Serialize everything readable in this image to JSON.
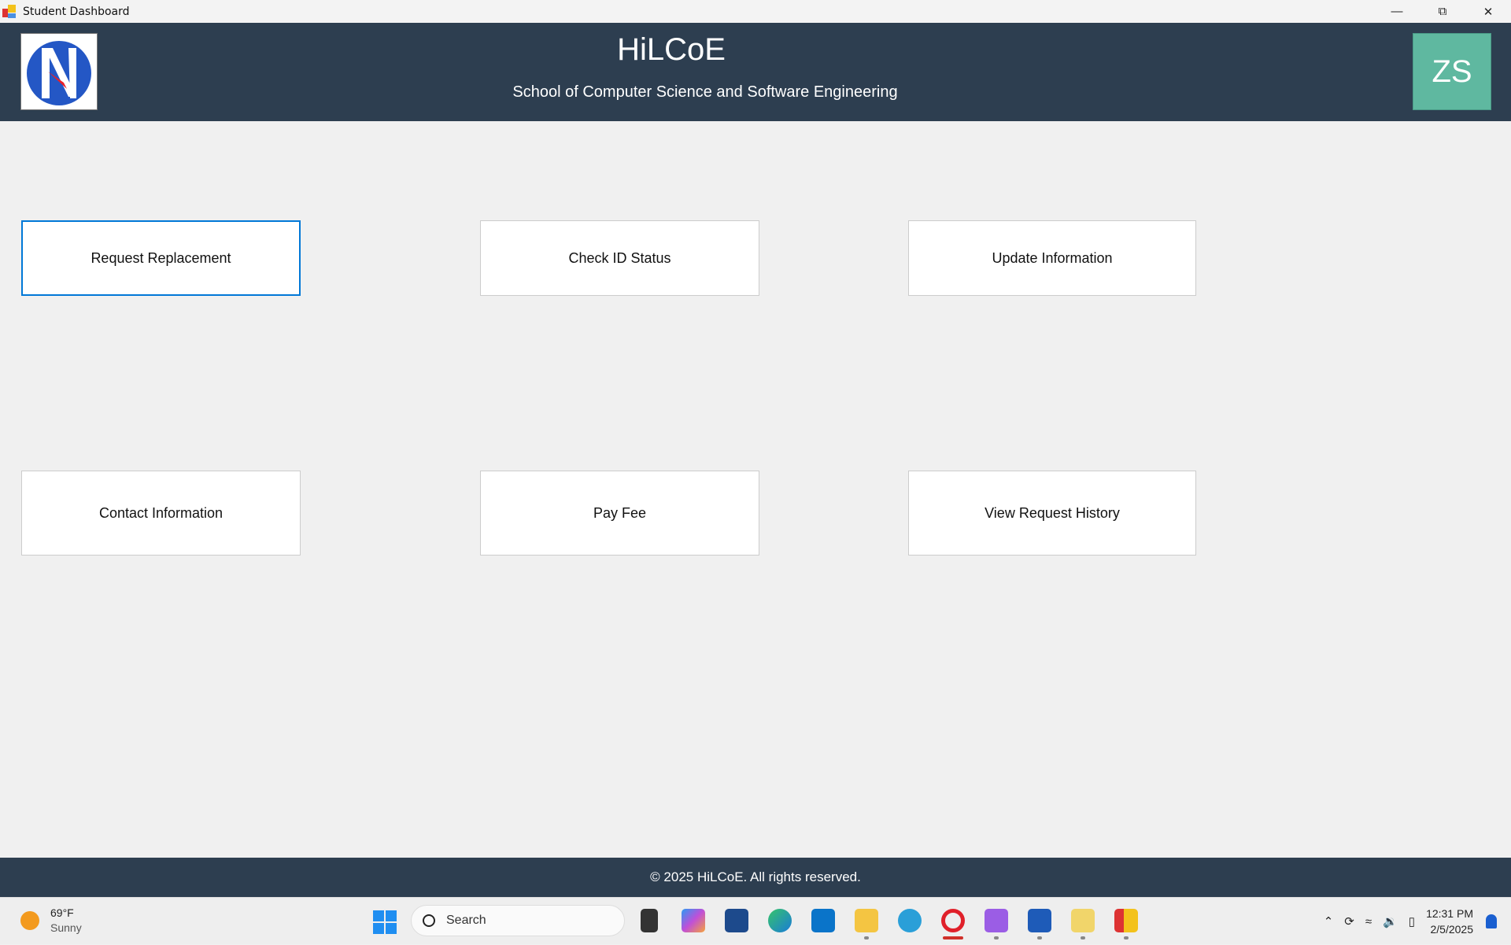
{
  "window": {
    "title": "Student Dashboard",
    "controls": [
      "minimize",
      "restore",
      "close"
    ]
  },
  "header": {
    "title": "HiLCoE",
    "subtitle": "School of Computer Science and Software Engineering",
    "avatar_initials": "ZS",
    "bg_color": "#2d3e50",
    "avatar_color": "#5fb8a0"
  },
  "actions": [
    {
      "label": "Request Replacement",
      "focused": true
    },
    {
      "label": "Check ID Status"
    },
    {
      "label": "Update Information"
    },
    {
      "label": "Contact Information"
    },
    {
      "label": "Pay Fee"
    },
    {
      "label": "View Request History"
    }
  ],
  "footer": {
    "text": "© 2025 HiLCoE. All rights reserved."
  },
  "taskbar": {
    "weather": {
      "temp": "69°F",
      "condition": "Sunny"
    },
    "search_placeholder": "Search",
    "apps": [
      "task-view",
      "copilot",
      "store",
      "edge",
      "dell",
      "file-explorer",
      "telegram",
      "opera",
      "visual-studio",
      "word",
      "snipping-tool",
      "student-dashboard"
    ],
    "time": "12:31 PM",
    "date": "2/5/2025"
  }
}
